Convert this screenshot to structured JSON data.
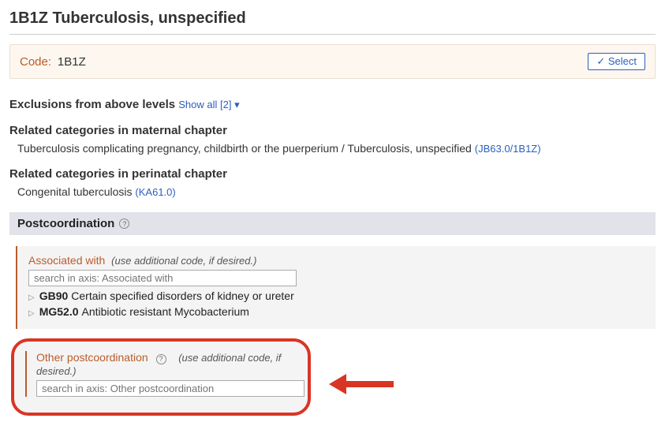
{
  "page": {
    "title": "1B1Z Tuberculosis, unspecified"
  },
  "codeBox": {
    "label": "Code:",
    "value": "1B1Z",
    "selectLabel": "✓ Select"
  },
  "exclusions": {
    "heading": "Exclusions from above levels",
    "showAll": "Show all [2] ▾"
  },
  "maternal": {
    "heading": "Related categories in maternal chapter",
    "text": "Tuberculosis complicating pregnancy, childbirth or the puerperium / Tuberculosis, unspecified",
    "code": "(JB63.0/1B1Z)"
  },
  "perinatal": {
    "heading": "Related categories in perinatal chapter",
    "text": "Congenital tuberculosis",
    "code": "(KA61.0)"
  },
  "postcoord": {
    "heading": "Postcoordination",
    "help": "?",
    "associated": {
      "title": "Associated with",
      "note": "(use additional code, if desired.)",
      "placeholder": "search in axis: Associated with",
      "items": [
        {
          "code": "GB90",
          "label": "Certain specified disorders of kidney or ureter"
        },
        {
          "code": "MG52.0",
          "label": "Antibiotic resistant Mycobacterium"
        }
      ]
    },
    "other": {
      "title": "Other postcoordination",
      "note": "(use additional code, if desired.)",
      "placeholder": "search in axis: Other postcoordination"
    }
  }
}
